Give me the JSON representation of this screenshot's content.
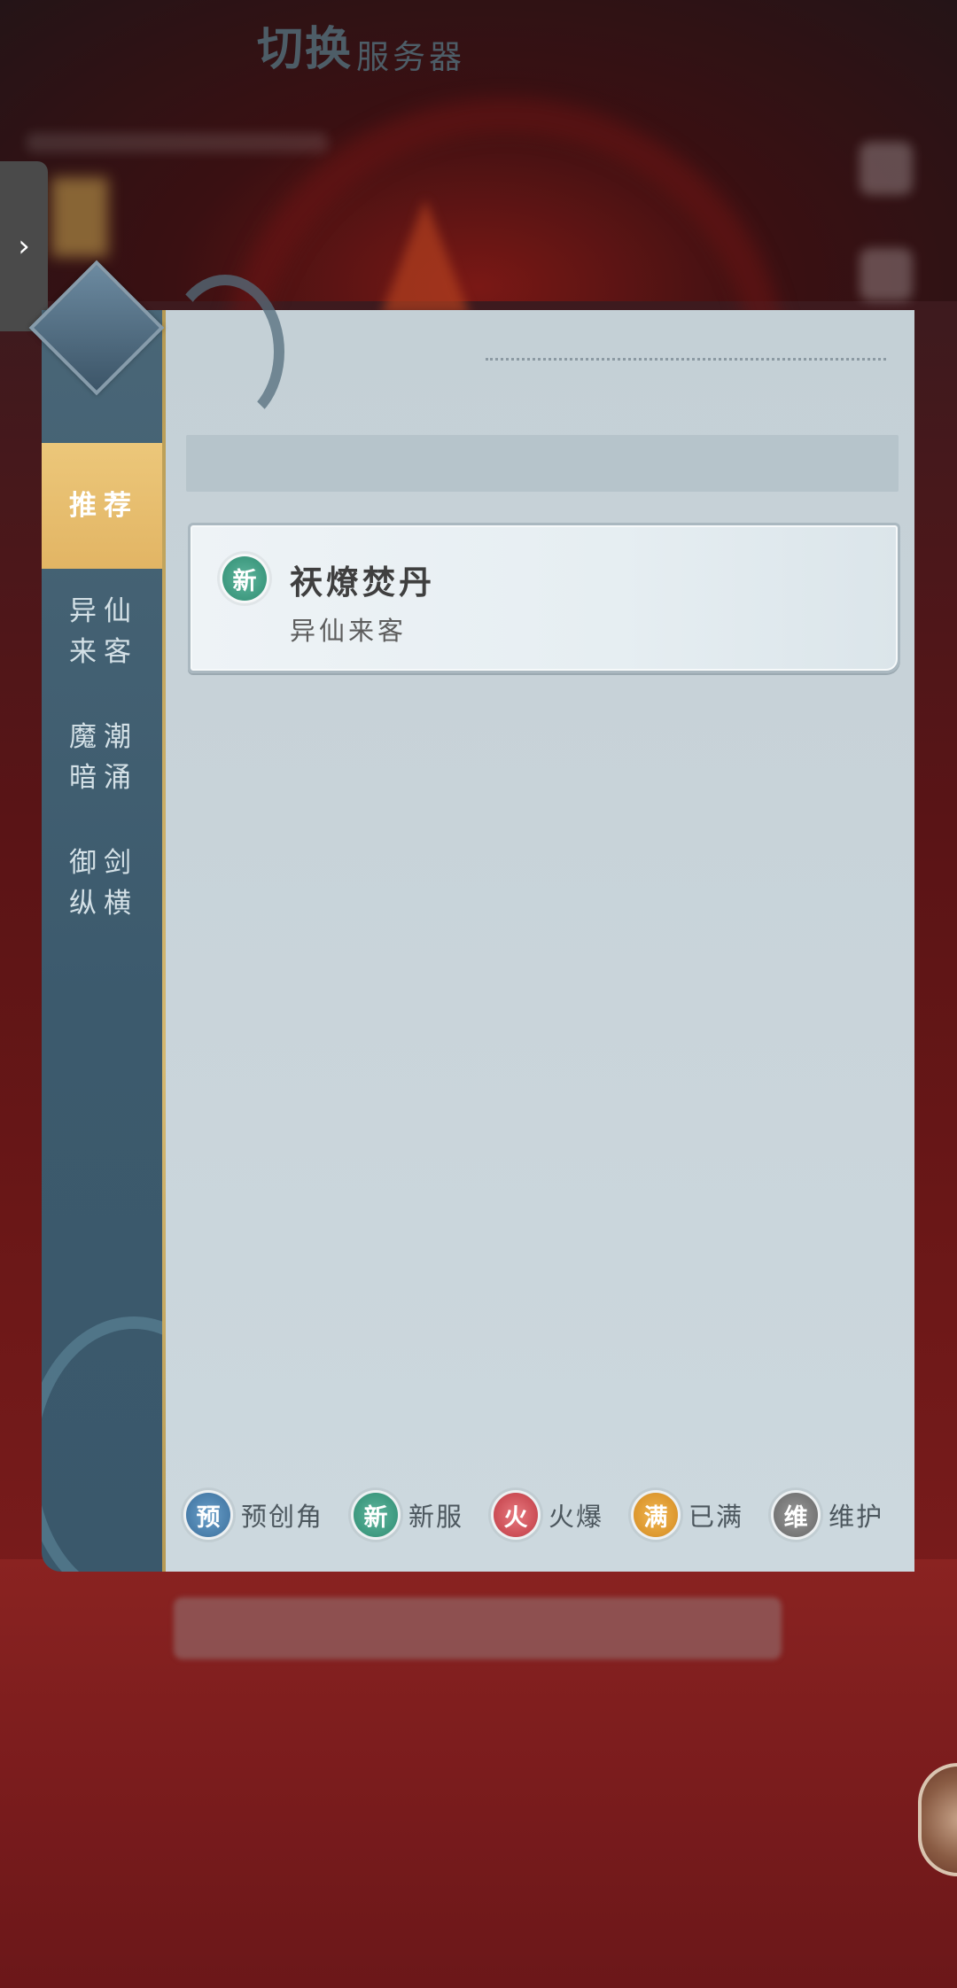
{
  "dialog": {
    "title_main": "切换",
    "title_sub": "服务器"
  },
  "sidebar": {
    "items": [
      {
        "label": "推荐"
      },
      {
        "label": "异仙\n来客"
      },
      {
        "label": "魔潮\n暗涌"
      },
      {
        "label": "御剑\n纵横"
      }
    ]
  },
  "servers": [
    {
      "badge": "新",
      "name": "祆燎焚丹",
      "group": "异仙来客"
    }
  ],
  "legend": [
    {
      "badge": "预",
      "label": "预创角"
    },
    {
      "badge": "新",
      "label": "新服"
    },
    {
      "badge": "火",
      "label": "火爆"
    },
    {
      "badge": "满",
      "label": "已满"
    },
    {
      "badge": "维",
      "label": "维护"
    }
  ],
  "drawer": {
    "icon": "chevron-right-icon"
  },
  "colors": {
    "new": "#2f8d72",
    "pre": "#3b6f9c",
    "hot": "#bf3942",
    "full": "#d48a1f",
    "maint": "#666666",
    "active_tab": "#e6bb6b"
  }
}
